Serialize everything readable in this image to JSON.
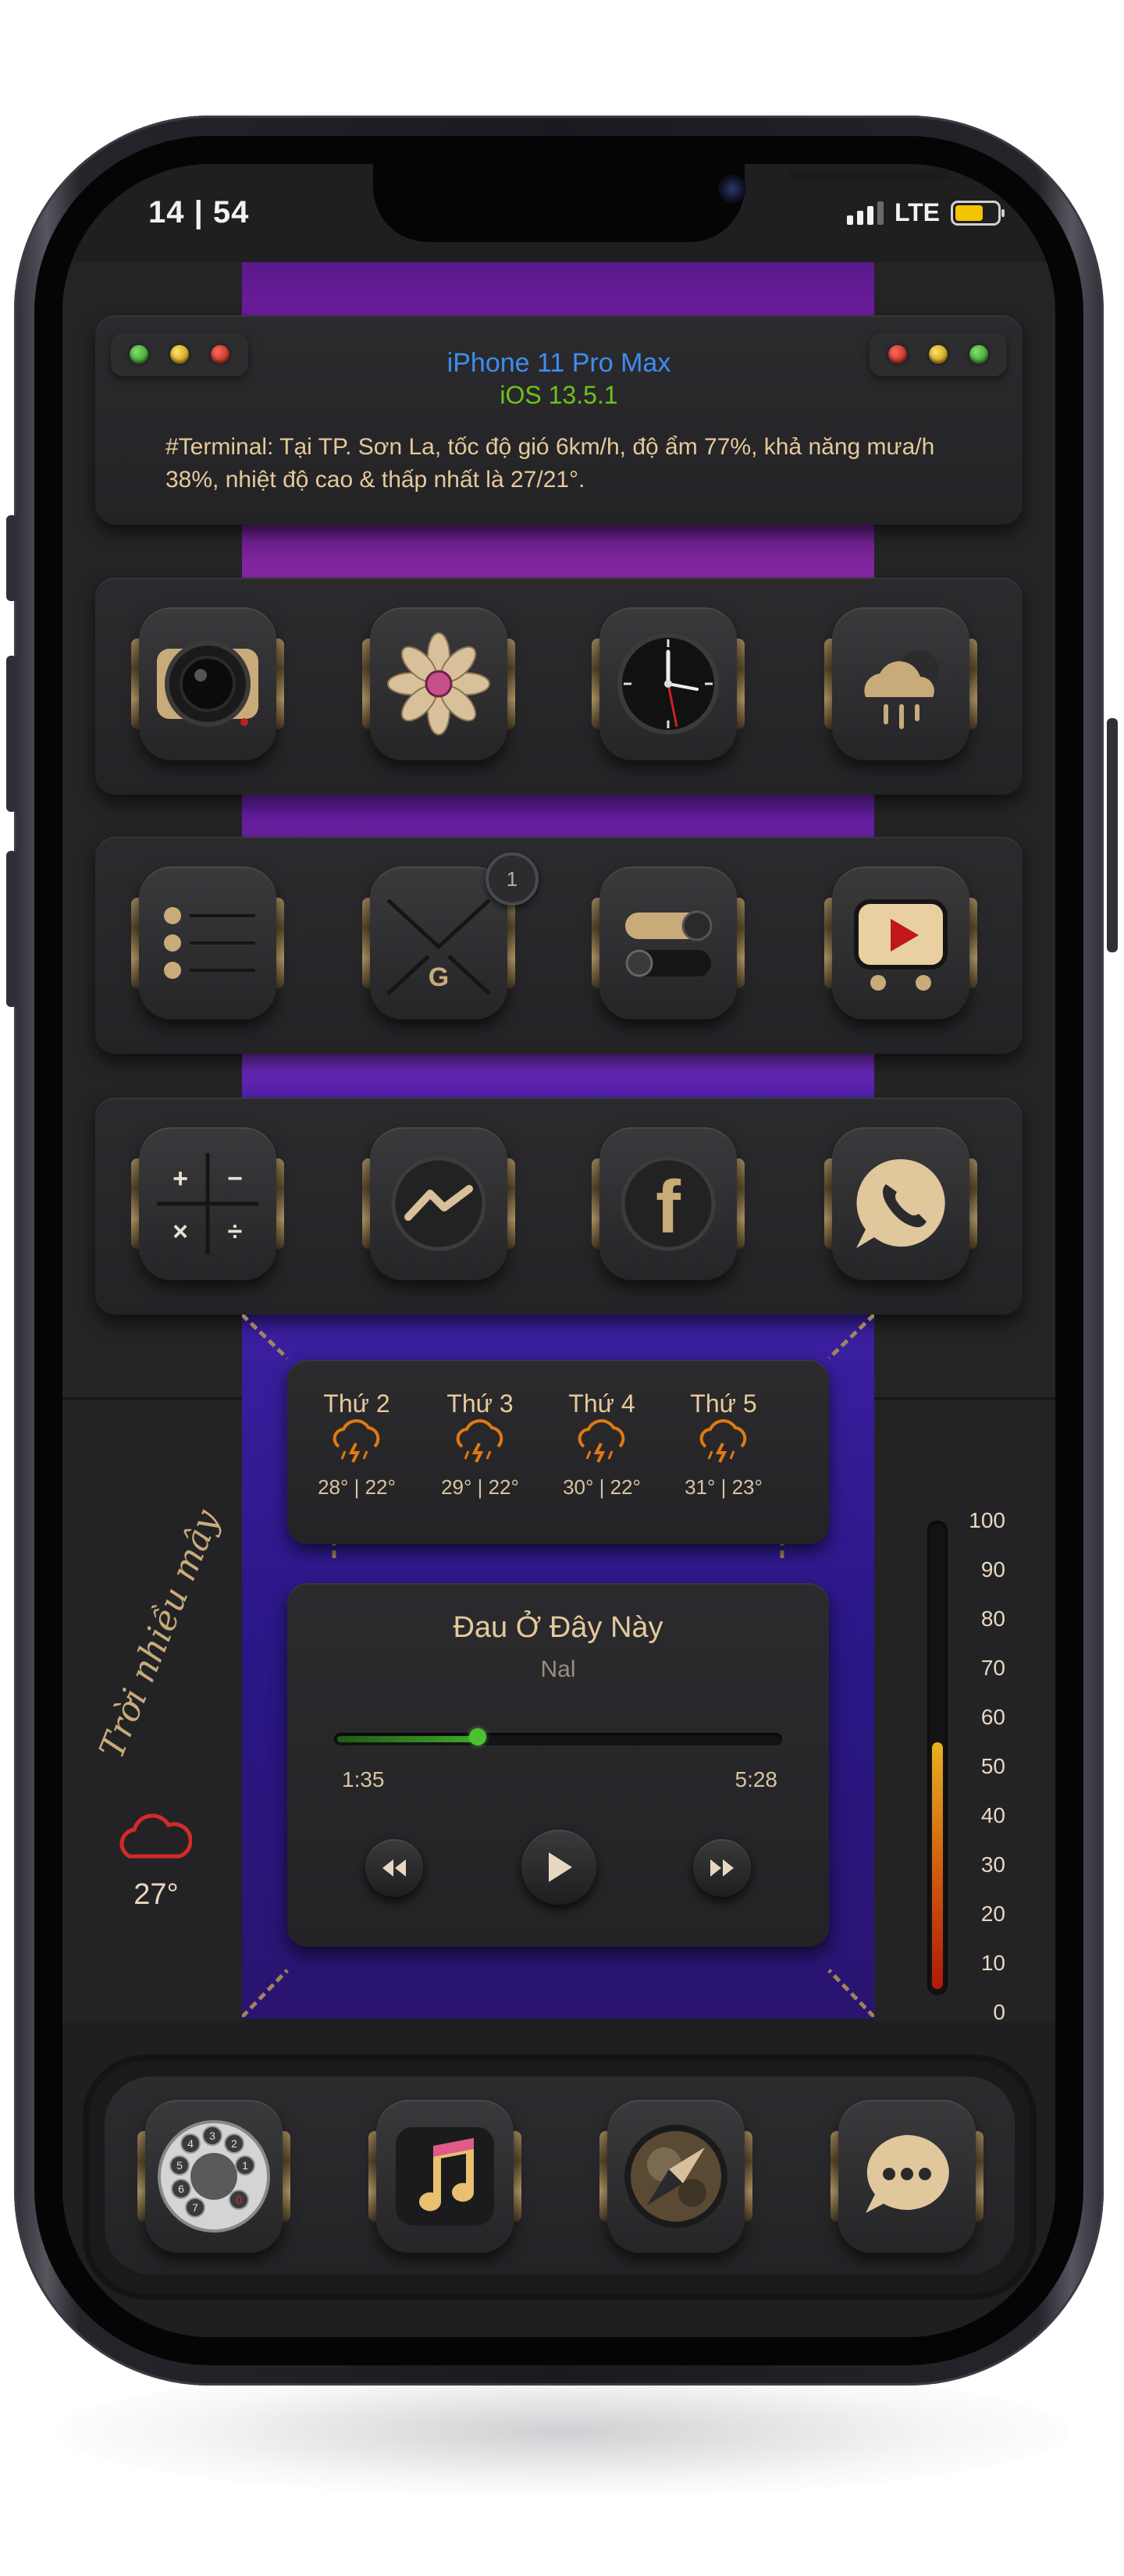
{
  "status_bar": {
    "time": "14 | 54",
    "network": "LTE",
    "battery_level": 0.7,
    "battery_color": "#f5c400"
  },
  "terminal": {
    "title": "iPhone 11 Pro Max",
    "subtitle": "iOS 13.5.1",
    "text": "#Terminal: Tại TP. Sơn La, tốc độ gió 6km/h, độ ẩm 77%, khả năng mưa/h 38%, nhiệt độ cao & thấp nhất là 27/21°.",
    "title_color": "#3d8df0",
    "subtitle_color": "#6fc21c"
  },
  "app_rows": [
    [
      "camera-icon",
      "flower-icon",
      "clock-icon",
      "cloud-rain-icon"
    ],
    [
      "list-icon",
      "mail-icon",
      "toggle-settings-icon",
      "video-player-icon"
    ],
    [
      "calculator-icon",
      "messenger-icon",
      "facebook-icon",
      "whatsapp-icon"
    ]
  ],
  "calculator_symbols": [
    "+",
    "−",
    "×",
    "÷"
  ],
  "mail_badge": "1",
  "mail_letter": "G",
  "facebook_letter": "f",
  "weather": {
    "days": [
      {
        "name": "Thứ 2",
        "temp": "28° | 22°"
      },
      {
        "name": "Thứ 3",
        "temp": "29° | 22°"
      },
      {
        "name": "Thứ 4",
        "temp": "30° | 22°"
      },
      {
        "name": "Thứ 5",
        "temp": "31° | 23°"
      }
    ],
    "current_temp": "27°"
  },
  "handwriting": "Trời nhiều mây",
  "music": {
    "title": "Đau Ở Đây Này",
    "artist": "Nal",
    "elapsed": "1:35",
    "duration": "5:28",
    "progress": 0.32
  },
  "gauge": {
    "labels": [
      "100",
      "90",
      "80",
      "70",
      "60",
      "50",
      "40",
      "30",
      "20",
      "10",
      "0"
    ],
    "level": 0.52
  },
  "dial_digits": [
    "1",
    "2",
    "3",
    "4",
    "5",
    "6",
    "7",
    "0"
  ],
  "dock": [
    "rotary-phone-icon",
    "music-note-icon",
    "compass-icon",
    "message-bubble-icon"
  ]
}
